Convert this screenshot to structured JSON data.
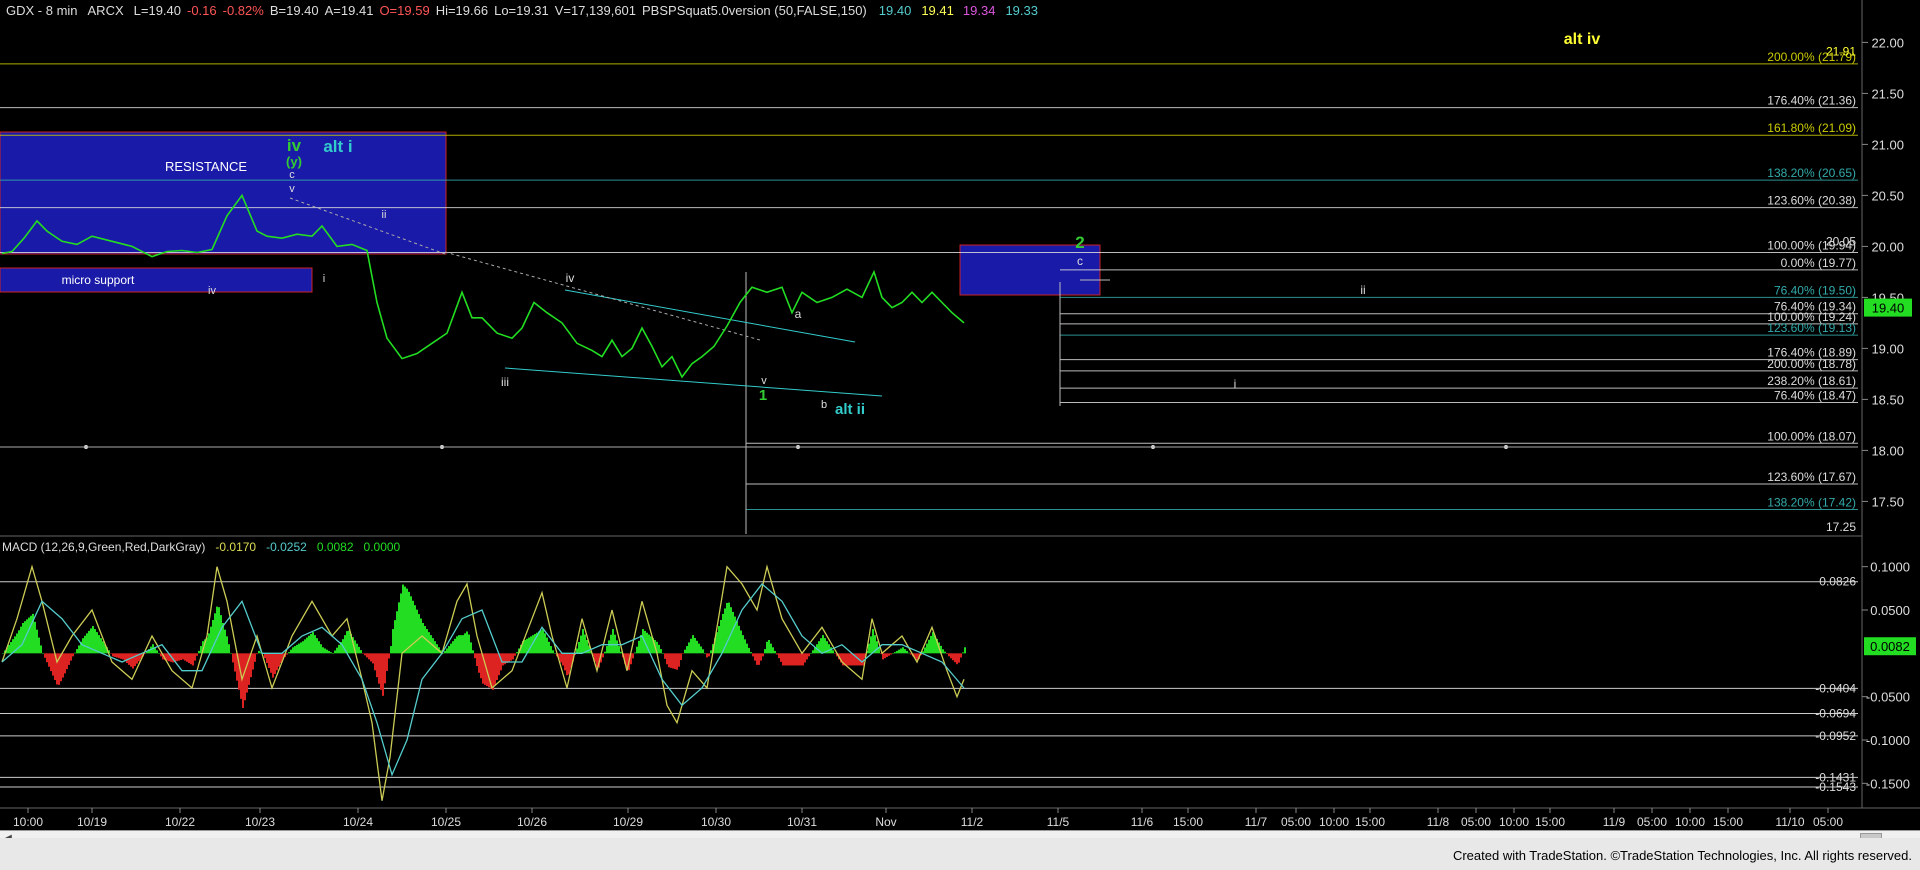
{
  "header": {
    "symbol": "GDX - 8 min",
    "exchange": "ARCX",
    "last": "L=19.40",
    "change": "-0.16",
    "pct_change": "-0.82%",
    "bid": "B=19.40",
    "ask": "A=19.41",
    "open": "O=19.59",
    "high": "Hi=19.66",
    "low": "Lo=19.31",
    "volume": "V=17,139,601",
    "indicator": "PBSPSquat5.0version (50,FALSE,150)",
    "ind_vals": [
      "19.40",
      "19.41",
      "19.34",
      "19.33"
    ]
  },
  "macd_header": {
    "label": "MACD (12,26,9,Green,Red,DarkGray)",
    "vals": [
      "-0.0170",
      "-0.0252",
      "0.0082",
      "0.0000"
    ]
  },
  "colors": {
    "background": "#000000",
    "price_line": "#22dd22",
    "wave_green": "#33cc33",
    "wave_cyan": "#33cccc",
    "wave_yellow": "#ffff33",
    "fib_yellow": "#cccc00",
    "fib_cyan": "#33aaaa",
    "box_blue": "#1a1aa8",
    "box_border": "#cc2222",
    "macd_fast": "#cccc55",
    "macd_slow": "#55cccc",
    "hist_pos": "#22dd22",
    "hist_neg": "#dd2222"
  },
  "footer": {
    "credit": "Created with TradeStation. ©TradeStation Technologies, Inc. All rights reserved."
  },
  "chart_data": [
    {
      "type": "line",
      "x_ticks": [
        "10:00",
        "10/19",
        "10/22",
        "10/23",
        "10/24",
        "10/25",
        "10/26",
        "10/29",
        "10/30",
        "10/31",
        "Nov",
        "11/2",
        "11/5",
        "11/6",
        "15:00",
        "11/7",
        "05:00",
        "10:00",
        "15:00",
        "11/8",
        "05:00",
        "10:00",
        "15:00",
        "11/9",
        "05:00",
        "10:00",
        "15:00",
        "11/10",
        "05:00"
      ],
      "y_ticks": [
        "22.00",
        "21.50",
        "21.00",
        "20.50",
        "20.00",
        "19.50",
        "19.00",
        "18.50",
        "18.00",
        "17.50"
      ],
      "ylim": [
        17.2,
        22.2
      ],
      "price_tag": "19.40",
      "series": [
        {
          "x": [
            0,
            10,
            22,
            35,
            45,
            60,
            75,
            90,
            110,
            130,
            150,
            165,
            180,
            195,
            210,
            225,
            240,
            255,
            265,
            280,
            295,
            310,
            320,
            335,
            350,
            365,
            375,
            385,
            400,
            415,
            430,
            445,
            460,
            470,
            480,
            495,
            510,
            520,
            532,
            545,
            560,
            575,
            590,
            600,
            610,
            620,
            630,
            640,
            650,
            660,
            670,
            680,
            690,
            700,
            712,
            725,
            738,
            750,
            765,
            780,
            790,
            800,
            815,
            830,
            845,
            860,
            872,
            880,
            890,
            900,
            910,
            920,
            930,
            940,
            950,
            962
          ],
          "values": [
            19.93,
            19.95,
            20.08,
            20.25,
            20.15,
            20.05,
            20.02,
            20.1,
            20.05,
            20.0,
            19.9,
            19.95,
            19.96,
            19.94,
            19.97,
            20.3,
            20.5,
            20.15,
            20.1,
            20.08,
            20.12,
            20.1,
            20.2,
            20.0,
            20.02,
            19.96,
            19.45,
            19.1,
            18.9,
            18.95,
            19.05,
            19.15,
            19.55,
            19.3,
            19.3,
            19.15,
            19.1,
            19.2,
            19.45,
            19.35,
            19.25,
            19.05,
            18.98,
            18.92,
            19.08,
            18.92,
            19.0,
            19.2,
            19.02,
            18.82,
            18.92,
            18.72,
            18.85,
            18.92,
            19.02,
            19.22,
            19.45,
            19.6,
            19.55,
            19.6,
            19.35,
            19.55,
            19.45,
            19.5,
            19.58,
            19.5,
            19.75,
            19.5,
            19.4,
            19.45,
            19.55,
            19.45,
            19.55,
            19.45,
            19.35,
            19.25
          ]
        }
      ],
      "fib_levels": [
        {
          "label": "200.00% (21.79)",
          "value": 21.79,
          "color": "#cccc00"
        },
        {
          "label": "176.40% (21.36)",
          "value": 21.36,
          "color": "#dddddd"
        },
        {
          "label": "161.80% (21.09)",
          "value": 21.09,
          "color": "#cccc00"
        },
        {
          "label": "138.20% (20.65)",
          "value": 20.65,
          "color": "#33aaaa"
        },
        {
          "label": "123.60% (20.38)",
          "value": 20.38,
          "color": "#dddddd"
        },
        {
          "label": "100.00% (19.94)",
          "value": 19.94,
          "color": "#dddddd"
        },
        {
          "label": "0.00% (19.77)",
          "value": 19.77,
          "color": "#dddddd"
        },
        {
          "label": "76.40% (19.50)",
          "value": 19.5,
          "color": "#33aaaa"
        },
        {
          "label": "76.40% (19.34)",
          "value": 19.34,
          "color": "#dddddd"
        },
        {
          "label": "100.00% (19.24)",
          "value": 19.24,
          "color": "#dddddd"
        },
        {
          "label": "123.60% (19.13)",
          "value": 19.13,
          "color": "#33aaaa"
        },
        {
          "label": "176.40% (18.89)",
          "value": 18.89,
          "color": "#dddddd"
        },
        {
          "label": "200.00% (18.78)",
          "value": 18.78,
          "color": "#dddddd"
        },
        {
          "label": "238.20% (18.61)",
          "value": 18.61,
          "color": "#dddddd"
        },
        {
          "label": "76.40% (18.47)",
          "value": 18.47,
          "color": "#dddddd"
        },
        {
          "label": "100.00% (18.07)",
          "value": 18.07,
          "color": "#dddddd"
        },
        {
          "label": "123.60% (17.67)",
          "value": 17.67,
          "color": "#dddddd"
        },
        {
          "label": "138.20% (17.42)",
          "value": 17.42,
          "color": "#33aaaa"
        }
      ],
      "price_labels": [
        {
          "label": "21.91",
          "value": 21.91,
          "color": "#ffff33"
        },
        {
          "label": "20.05",
          "value": 20.05,
          "color": "#dddddd"
        },
        {
          "label": "17.25",
          "value": 17.25,
          "color": "#dddddd"
        }
      ],
      "annotations": [
        {
          "text": "RESISTANCE",
          "color": "#ffffff"
        },
        {
          "text": "micro support",
          "color": "#ffffff"
        },
        {
          "text": "iv",
          "color": "#33cc33"
        },
        {
          "text": "(y)",
          "color": "#33cc33"
        },
        {
          "text": "alt i",
          "color": "#33cccc"
        },
        {
          "text": "c",
          "color": "#dddddd"
        },
        {
          "text": "v",
          "color": "#dddddd"
        },
        {
          "text": "ii",
          "color": "#dddddd"
        },
        {
          "text": "iv",
          "color": "#dddddd"
        },
        {
          "text": "i",
          "color": "#dddddd"
        },
        {
          "text": "iv",
          "color": "#dddddd"
        },
        {
          "text": "iii",
          "color": "#dddddd"
        },
        {
          "text": "a",
          "color": "#dddddd"
        },
        {
          "text": "v",
          "color": "#dddddd"
        },
        {
          "text": "1",
          "color": "#33cc33"
        },
        {
          "text": "b",
          "color": "#dddddd"
        },
        {
          "text": "alt ii",
          "color": "#33cccc"
        },
        {
          "text": "2",
          "color": "#33cc33"
        },
        {
          "text": "c",
          "color": "#dddddd"
        },
        {
          "text": "ii",
          "color": "#dddddd"
        },
        {
          "text": "i",
          "color": "#dddddd"
        },
        {
          "text": "alt iv",
          "color": "#ffff33"
        }
      ]
    },
    {
      "type": "line",
      "y_ticks": [
        "0.1000",
        "0.0500",
        "-0.0500",
        "-0.1000",
        "-0.1500"
      ],
      "ylim": [
        -0.175,
        0.125
      ],
      "value_tag": "0.0082",
      "levels": [
        {
          "label": "0.0826",
          "value": 0.0826
        },
        {
          "label": "-0.0404",
          "value": -0.0404
        },
        {
          "label": "-0.0694",
          "value": -0.0694
        },
        {
          "label": "-0.0952",
          "value": -0.0952
        },
        {
          "label": "-0.1431",
          "value": -0.1431
        },
        {
          "label": "-0.1543",
          "value": -0.1543
        }
      ],
      "series": [
        {
          "name": "MACD",
          "x": [
            0,
            15,
            30,
            40,
            55,
            70,
            90,
            110,
            130,
            150,
            170,
            190,
            205,
            215,
            225,
            240,
            255,
            270,
            290,
            310,
            330,
            345,
            360,
            370,
            380,
            388,
            400,
            420,
            440,
            455,
            465,
            475,
            490,
            510,
            530,
            540,
            550,
            565,
            580,
            595,
            610,
            625,
            640,
            655,
            665,
            675,
            690,
            705,
            715,
            725,
            740,
            755,
            765,
            780,
            800,
            820,
            840,
            860,
            870,
            880,
            900,
            915,
            930,
            945,
            955,
            962
          ],
          "values": [
            -0.01,
            0.04,
            0.1,
            0.06,
            -0.01,
            0.02,
            0.05,
            -0.01,
            -0.03,
            0.02,
            -0.02,
            -0.04,
            0.02,
            0.1,
            0.06,
            -0.03,
            0.02,
            -0.04,
            0.02,
            0.06,
            0.02,
            0.04,
            -0.03,
            -0.08,
            -0.17,
            -0.12,
            0.0,
            0.02,
            0.0,
            0.06,
            0.08,
            0.02,
            -0.04,
            -0.02,
            0.04,
            0.07,
            0.02,
            -0.04,
            0.04,
            -0.02,
            0.05,
            -0.02,
            0.06,
            0.0,
            -0.06,
            -0.08,
            -0.02,
            -0.04,
            0.03,
            0.1,
            0.08,
            0.05,
            0.1,
            0.04,
            0.0,
            0.03,
            -0.01,
            -0.03,
            0.04,
            0.0,
            0.02,
            -0.01,
            0.03,
            -0.02,
            -0.05,
            -0.03
          ]
        },
        {
          "name": "MACDAvg",
          "x": [
            0,
            20,
            40,
            60,
            80,
            100,
            120,
            140,
            160,
            180,
            200,
            220,
            240,
            260,
            280,
            300,
            320,
            340,
            360,
            375,
            390,
            405,
            420,
            440,
            460,
            480,
            500,
            520,
            540,
            560,
            580,
            600,
            620,
            640,
            660,
            680,
            700,
            720,
            740,
            760,
            780,
            800,
            820,
            840,
            860,
            880,
            900,
            920,
            940,
            962
          ],
          "values": [
            -0.01,
            0.01,
            0.06,
            0.04,
            0.01,
            0.0,
            -0.01,
            0.0,
            0.01,
            -0.02,
            -0.02,
            0.03,
            0.06,
            0.0,
            0.0,
            0.02,
            0.03,
            0.01,
            -0.03,
            -0.08,
            -0.14,
            -0.1,
            -0.03,
            0.0,
            0.04,
            0.05,
            -0.01,
            -0.01,
            0.03,
            0.0,
            0.0,
            0.01,
            0.01,
            0.02,
            -0.03,
            -0.06,
            -0.04,
            0.0,
            0.05,
            0.08,
            0.06,
            0.02,
            0.0,
            0.01,
            -0.01,
            0.01,
            0.01,
            0.0,
            -0.01,
            -0.04
          ]
        }
      ]
    }
  ]
}
